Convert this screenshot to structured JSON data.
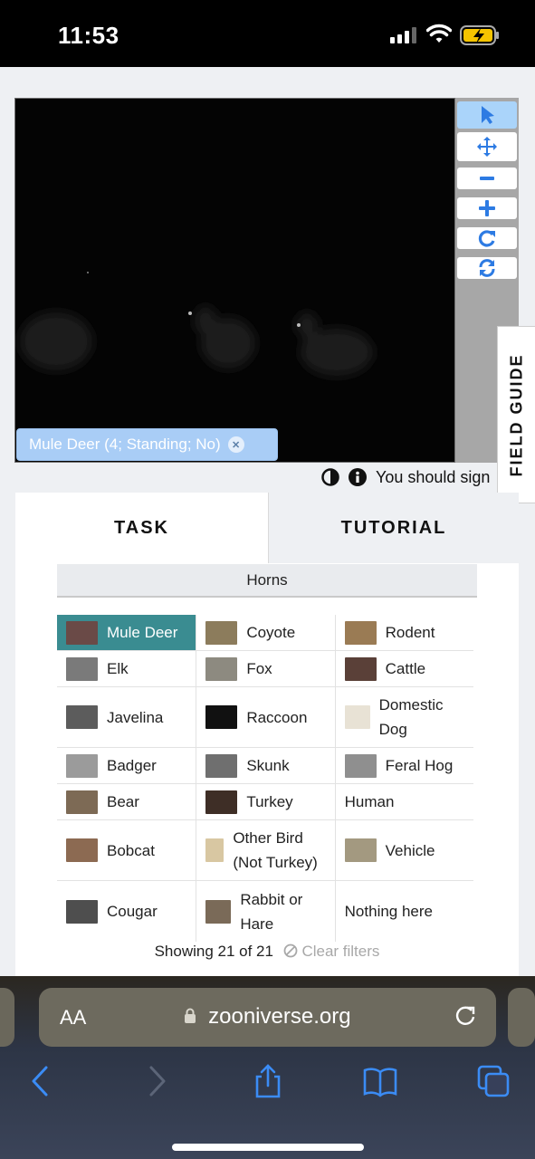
{
  "status_bar": {
    "time": "11:53"
  },
  "viewer": {
    "tools": [
      "pointer-icon",
      "move-icon",
      "zoom-out-icon",
      "zoom-in-icon",
      "rotate-icon",
      "reset-icon"
    ],
    "annotation_chip": "Mule Deer (4; Standing; No)",
    "field_guide_label": "FIELD GUIDE",
    "sign_in_notice": "You should sign"
  },
  "tabs": [
    {
      "label": "TASK"
    },
    {
      "label": "TUTORIAL"
    }
  ],
  "filter": {
    "label": "Horns"
  },
  "species": [
    {
      "label": "Mule Deer",
      "thumb": "#6a4a47",
      "selected": true
    },
    {
      "label": "Coyote",
      "thumb": "#8c7c5c"
    },
    {
      "label": "Rodent",
      "thumb": "#9a7b54"
    },
    {
      "label": "Elk",
      "thumb": "#7a7a7a"
    },
    {
      "label": "Fox",
      "thumb": "#8d8a80"
    },
    {
      "label": "Cattle",
      "thumb": "#5a4038"
    },
    {
      "label": "Javelina",
      "thumb": "#5c5c5c"
    },
    {
      "label": "Raccoon",
      "thumb": "#111111"
    },
    {
      "label": "Domestic Dog",
      "thumb": "#e8e2d5"
    },
    {
      "label": "Badger",
      "thumb": "#9b9b9b"
    },
    {
      "label": "Skunk",
      "thumb": "#6f6f6f"
    },
    {
      "label": "Feral Hog",
      "thumb": "#8f8f8f"
    },
    {
      "label": "Bear",
      "thumb": "#7d6a55"
    },
    {
      "label": "Turkey",
      "thumb": "#3e2e26"
    },
    {
      "label": "Human",
      "thumb": ""
    },
    {
      "label": "Bobcat",
      "thumb": "#8c6a52"
    },
    {
      "label": "Other Bird (Not Turkey)",
      "thumb": "#d8c7a2"
    },
    {
      "label": "Vehicle",
      "thumb": "#a39980"
    },
    {
      "label": "Cougar",
      "thumb": "#4e4e4e"
    },
    {
      "label": "Rabbit or Hare",
      "thumb": "#7a6a58"
    },
    {
      "label": "Nothing here",
      "thumb": ""
    }
  ],
  "results": {
    "showing": "Showing 21 of 21",
    "clear_filters": "Clear filters"
  },
  "browser": {
    "aa_label": "AA",
    "url": "zooniverse.org"
  },
  "colors": {
    "accent": "#3a8c91",
    "tool_blue": "#2d7be3",
    "chip": "#a9cdf6"
  }
}
